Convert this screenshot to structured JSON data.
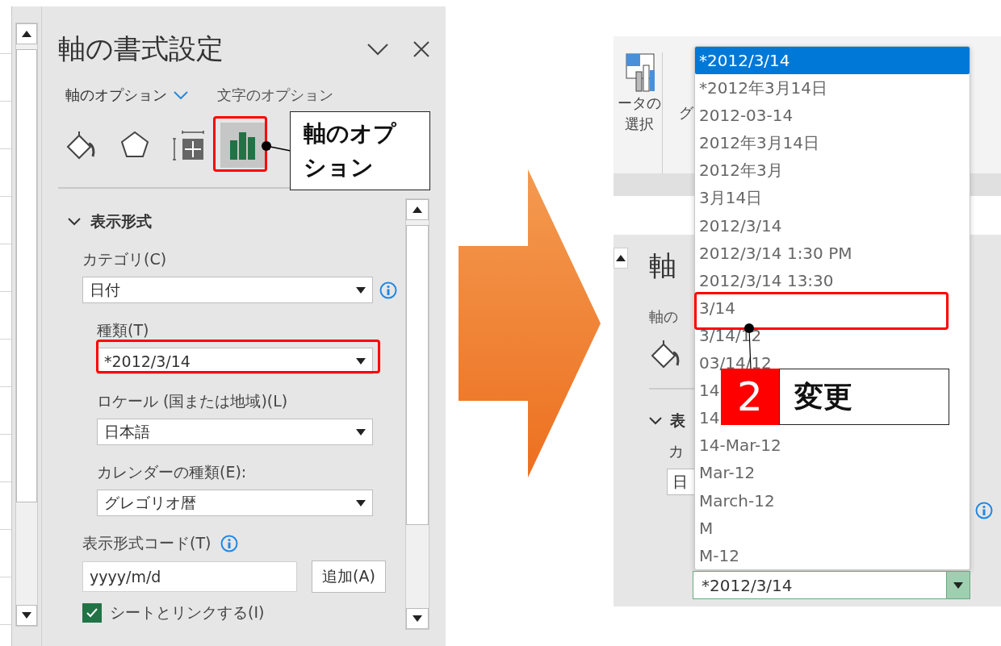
{
  "format_pane": {
    "title": "軸の書式設定",
    "tabs": [
      {
        "label": "軸のオプション",
        "selected": true
      },
      {
        "label": "文字のオプション",
        "selected": false
      }
    ],
    "icon_tabs": [
      {
        "kind": "fill",
        "selected": false
      },
      {
        "kind": "effects",
        "selected": false
      },
      {
        "kind": "size",
        "selected": false
      },
      {
        "kind": "axis",
        "selected": true
      }
    ],
    "section": {
      "title": "表示形式",
      "expanded": true
    },
    "fields": [
      {
        "label": "カテゴリ(C)",
        "value": "日付"
      },
      {
        "label": "種類(T)",
        "value": "*2012/3/14"
      },
      {
        "label": "ロケール (国または地域)(L)",
        "value": "日本語"
      },
      {
        "label": "カレンダーの種類(E):",
        "value": "グレゴリオ暦"
      }
    ],
    "format_code": {
      "label": "表示形式コード(T)",
      "value": "yyyy/m/d"
    },
    "add_button": "追加(A)",
    "link_checkbox": {
      "label": "シートとリンクする(I)",
      "checked": true
    }
  },
  "callout_1": {
    "text": "軸のオプション"
  },
  "right_view": {
    "ribbon_texts": [
      "ータの",
      "選択"
    ],
    "ribbon_cut": "グ",
    "pane_title_cut": "軸",
    "tab_cut": "軸の",
    "section_cut": "表",
    "label_cut": "カ",
    "field_cut": "日",
    "dropdown": {
      "items": [
        {
          "label": "*2012/3/14",
          "selected": true
        },
        {
          "label": "*2012年3月14日",
          "selected": false
        },
        {
          "label": "2012-03-14",
          "selected": false
        },
        {
          "label": "2012年3月14日",
          "selected": false
        },
        {
          "label": "2012年3月",
          "selected": false
        },
        {
          "label": "3月14日",
          "selected": false
        },
        {
          "label": "2012/3/14",
          "selected": false
        },
        {
          "label": "2012/3/14 1:30 PM",
          "selected": false
        },
        {
          "label": "2012/3/14 13:30",
          "selected": false
        },
        {
          "label": "3/14",
          "selected": false
        },
        {
          "label": "3/14/12",
          "selected": false
        },
        {
          "label": "03/14/12",
          "selected": false
        },
        {
          "label": "14",
          "selected": false
        },
        {
          "label": "14",
          "selected": false
        },
        {
          "label": "14-Mar-12",
          "selected": false
        },
        {
          "label": "Mar-12",
          "selected": false
        },
        {
          "label": "March-12",
          "selected": false
        },
        {
          "label": "M",
          "selected": false
        },
        {
          "label": "M-12",
          "selected": false
        }
      ],
      "value": "*2012/3/14"
    }
  },
  "callout_2": {
    "number": "2",
    "text": "変更"
  }
}
